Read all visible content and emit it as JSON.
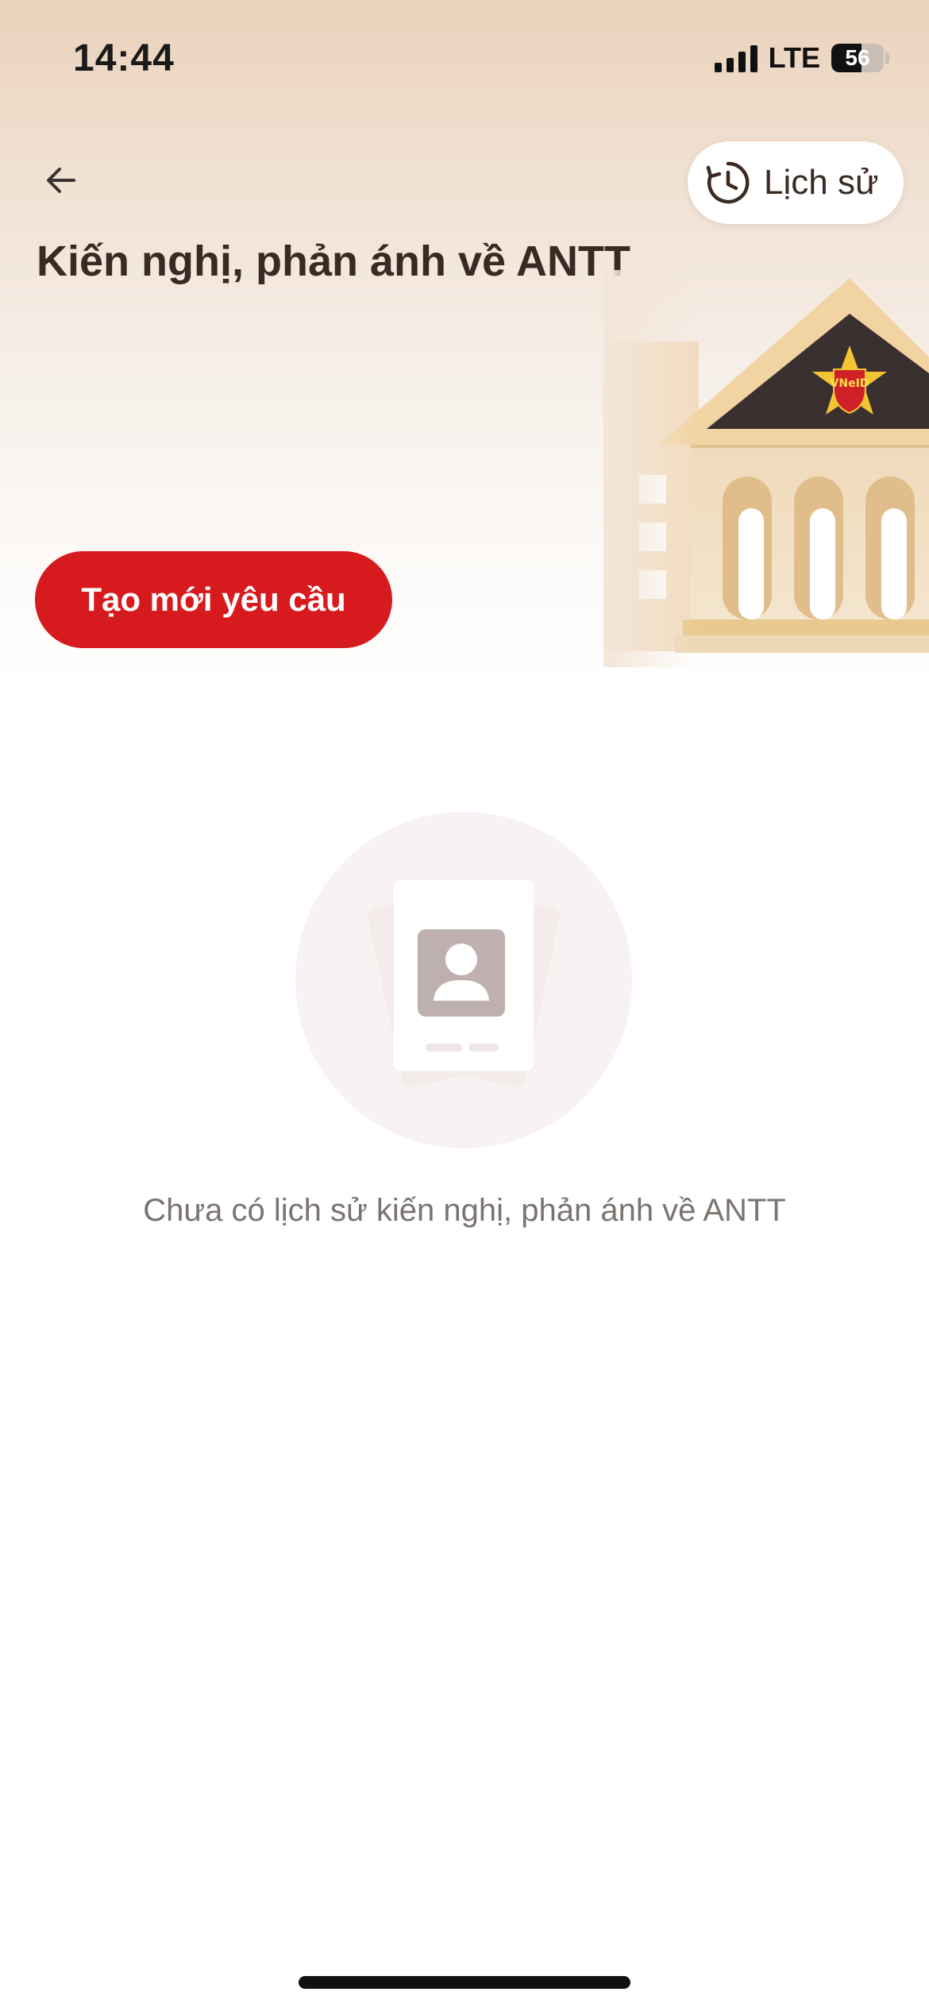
{
  "status_bar": {
    "time": "14:44",
    "network": "LTE",
    "battery": "56"
  },
  "header": {
    "back_icon": "arrow-left-icon",
    "history_icon": "clock-history-icon",
    "history_label": "Lịch sử",
    "title": "Kiến nghị, phản ánh về ANTT",
    "emblem_text": "VNeID"
  },
  "actions": {
    "create_label": "Tạo mới yêu cầu"
  },
  "empty_state": {
    "icon": "id-card-icon",
    "message": "Chưa có lịch sử kiến nghị, phản ánh về ANTT"
  },
  "colors": {
    "primary_red": "#d71a1d",
    "title_brown": "#3a2a24",
    "header_gradient_top": "#ead2bb"
  }
}
